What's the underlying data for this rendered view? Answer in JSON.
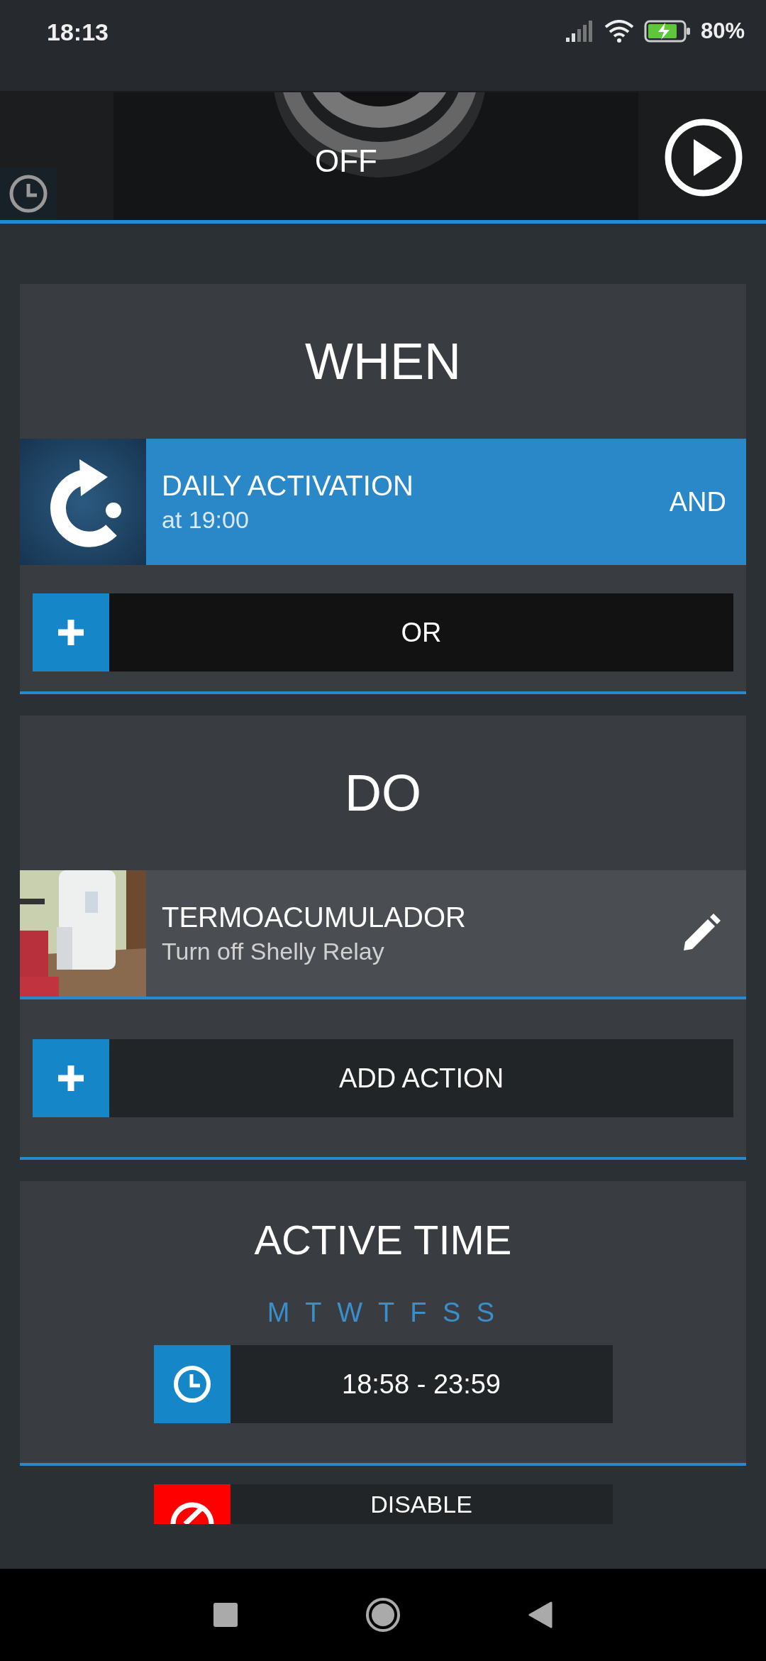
{
  "status_bar": {
    "time": "18:13",
    "battery": "80%"
  },
  "hero": {
    "state": "OFF"
  },
  "when": {
    "title": "WHEN",
    "trigger": {
      "title": "DAILY ACTIVATION",
      "subtitle": "at 19:00",
      "connector": "AND"
    },
    "add_button": "OR"
  },
  "do": {
    "title": "DO",
    "action": {
      "title": "TERMOACUMULADOR",
      "subtitle": "Turn off Shelly Relay"
    },
    "add_button": "ADD ACTION"
  },
  "active_time": {
    "title": "ACTIVE TIME",
    "days": "M T W T F S S",
    "range": "18:58 - 23:59"
  },
  "disable_button": "DISABLE"
}
